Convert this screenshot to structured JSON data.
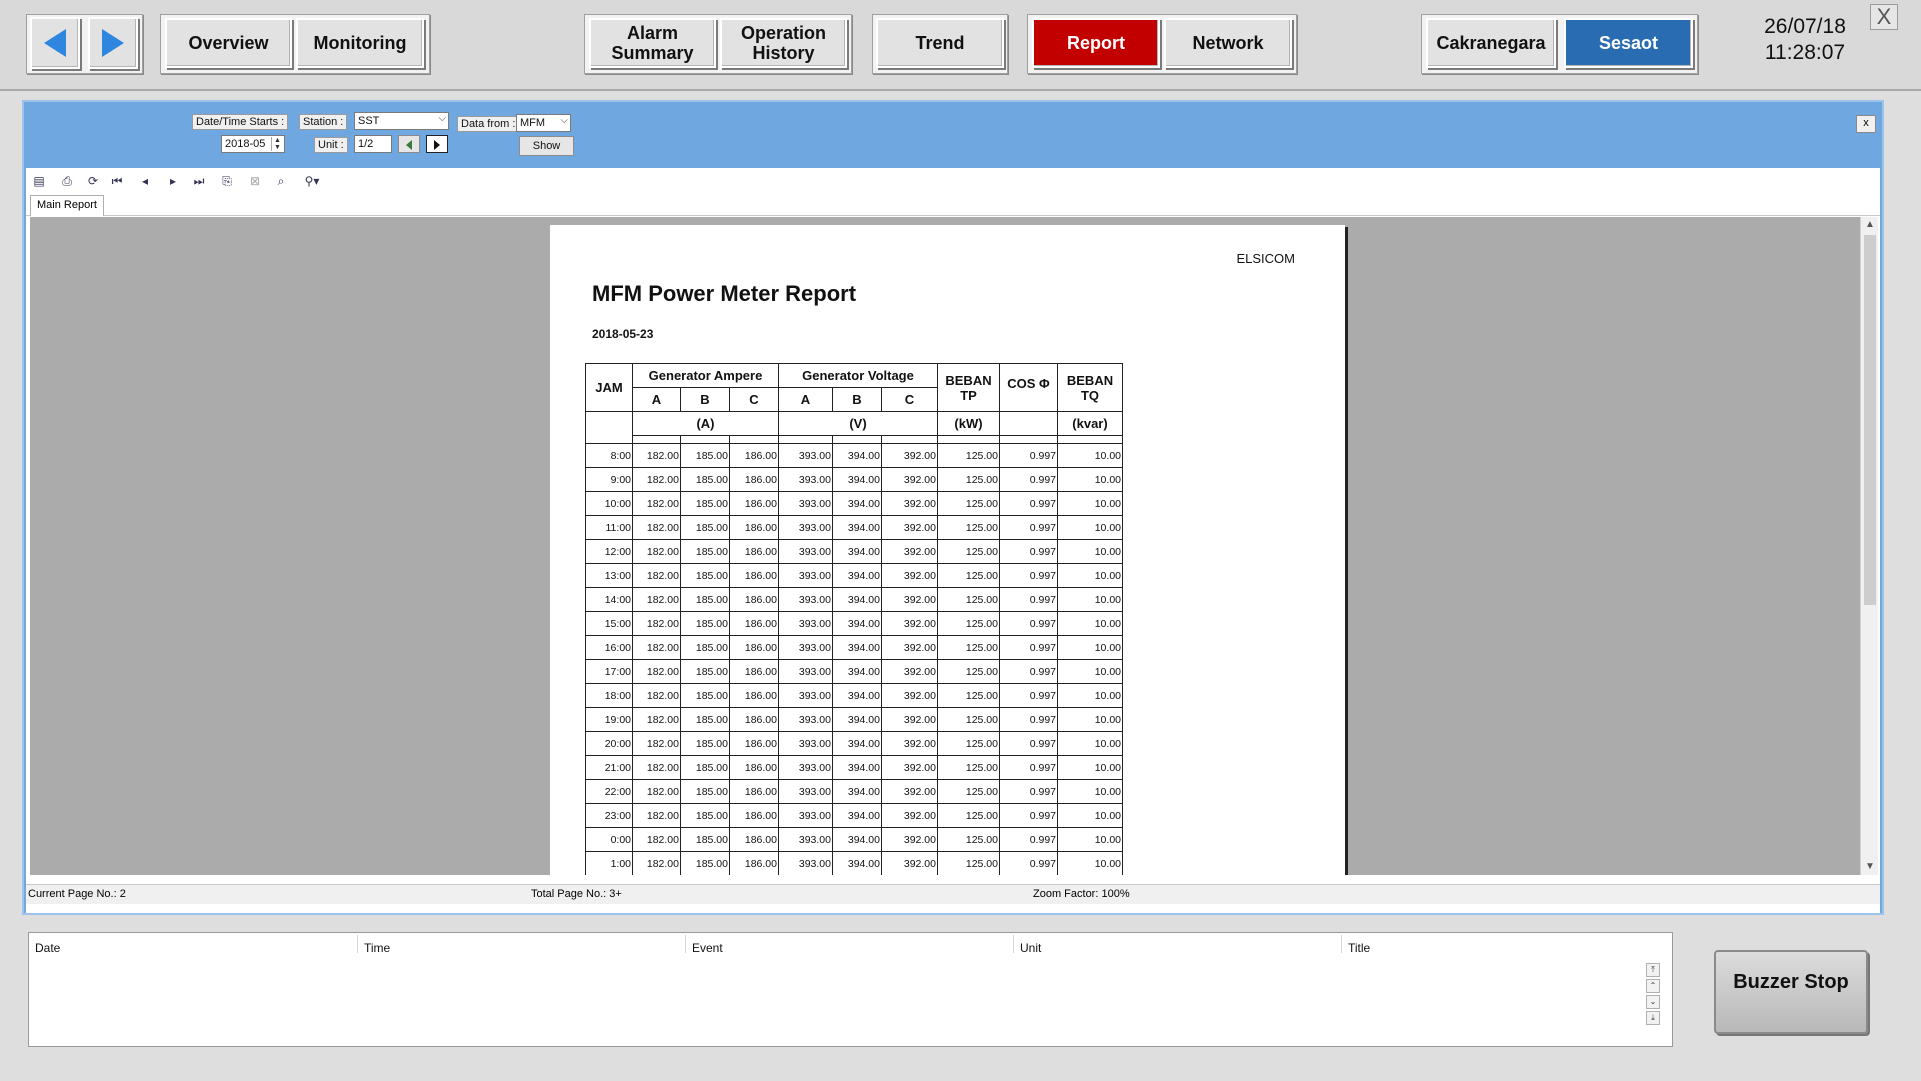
{
  "nav": {
    "back_icon": "arrow-left-icon",
    "forward_icon": "arrow-right-icon",
    "overview": "Overview",
    "monitoring": "Monitoring",
    "alarm_summary": "Alarm Summary",
    "operation_history": "Operation History",
    "trend": "Trend",
    "report": "Report",
    "network": "Network",
    "cakranegara": "Cakranegara",
    "sesaot": "Sesaot",
    "date": "26/07/18",
    "time": "11:28:07",
    "close": "X",
    "colors": {
      "active_report": "#c30000",
      "active_station": "#2a6cb2",
      "nav_arrow": "#2e86de"
    }
  },
  "filter": {
    "datetime_label": "Date/Time Starts :",
    "datetime_value": "2018-05",
    "station_label": "Station :",
    "station_value": "SST",
    "unit_label": "Unit :",
    "unit_value": "1/2",
    "datafrom_label": "Data from :",
    "datafrom_value": "MFM",
    "show_button": "Show",
    "close": "x"
  },
  "viewer": {
    "tab": "Main Report",
    "status_current": "Current Page No.: 2",
    "status_total": "Total Page No.: 3+",
    "status_zoom": "Zoom Factor: 100%"
  },
  "report": {
    "company": "ELSICOM",
    "title": "MFM Power Meter Report",
    "date": "2018-05-23",
    "headers": {
      "jam": "JAM",
      "gen_ampere": "Generator Ampere",
      "gen_voltage": "Generator Voltage",
      "a": "A",
      "b": "B",
      "c": "C",
      "ampere_unit": "(A)",
      "voltage_unit": "(V)",
      "beban_tp": "BEBAN TP",
      "beban_tp_unit": "(kW)",
      "cos": "COS Φ",
      "beban_tq": "BEBAN TQ",
      "beban_tq_unit": "(kvar)"
    },
    "rows": [
      [
        "8:00",
        "182.00",
        "185.00",
        "186.00",
        "393.00",
        "394.00",
        "392.00",
        "125.00",
        "0.997",
        "10.00"
      ],
      [
        "9:00",
        "182.00",
        "185.00",
        "186.00",
        "393.00",
        "394.00",
        "392.00",
        "125.00",
        "0.997",
        "10.00"
      ],
      [
        "10:00",
        "182.00",
        "185.00",
        "186.00",
        "393.00",
        "394.00",
        "392.00",
        "125.00",
        "0.997",
        "10.00"
      ],
      [
        "11:00",
        "182.00",
        "185.00",
        "186.00",
        "393.00",
        "394.00",
        "392.00",
        "125.00",
        "0.997",
        "10.00"
      ],
      [
        "12:00",
        "182.00",
        "185.00",
        "186.00",
        "393.00",
        "394.00",
        "392.00",
        "125.00",
        "0.997",
        "10.00"
      ],
      [
        "13:00",
        "182.00",
        "185.00",
        "186.00",
        "393.00",
        "394.00",
        "392.00",
        "125.00",
        "0.997",
        "10.00"
      ],
      [
        "14:00",
        "182.00",
        "185.00",
        "186.00",
        "393.00",
        "394.00",
        "392.00",
        "125.00",
        "0.997",
        "10.00"
      ],
      [
        "15:00",
        "182.00",
        "185.00",
        "186.00",
        "393.00",
        "394.00",
        "392.00",
        "125.00",
        "0.997",
        "10.00"
      ],
      [
        "16:00",
        "182.00",
        "185.00",
        "186.00",
        "393.00",
        "394.00",
        "392.00",
        "125.00",
        "0.997",
        "10.00"
      ],
      [
        "17:00",
        "182.00",
        "185.00",
        "186.00",
        "393.00",
        "394.00",
        "392.00",
        "125.00",
        "0.997",
        "10.00"
      ],
      [
        "18:00",
        "182.00",
        "185.00",
        "186.00",
        "393.00",
        "394.00",
        "392.00",
        "125.00",
        "0.997",
        "10.00"
      ],
      [
        "19:00",
        "182.00",
        "185.00",
        "186.00",
        "393.00",
        "394.00",
        "392.00",
        "125.00",
        "0.997",
        "10.00"
      ],
      [
        "20:00",
        "182.00",
        "185.00",
        "186.00",
        "393.00",
        "394.00",
        "392.00",
        "125.00",
        "0.997",
        "10.00"
      ],
      [
        "21:00",
        "182.00",
        "185.00",
        "186.00",
        "393.00",
        "394.00",
        "392.00",
        "125.00",
        "0.997",
        "10.00"
      ],
      [
        "22:00",
        "182.00",
        "185.00",
        "186.00",
        "393.00",
        "394.00",
        "392.00",
        "125.00",
        "0.997",
        "10.00"
      ],
      [
        "23:00",
        "182.00",
        "185.00",
        "186.00",
        "393.00",
        "394.00",
        "392.00",
        "125.00",
        "0.997",
        "10.00"
      ],
      [
        "0:00",
        "182.00",
        "185.00",
        "186.00",
        "393.00",
        "394.00",
        "392.00",
        "125.00",
        "0.997",
        "10.00"
      ],
      [
        "1:00",
        "182.00",
        "185.00",
        "186.00",
        "393.00",
        "394.00",
        "392.00",
        "125.00",
        "0.997",
        "10.00"
      ]
    ]
  },
  "eventlog": {
    "columns": [
      "Date",
      "Time",
      "Event",
      "Unit",
      "Title"
    ]
  },
  "buzzer": {
    "label": "Buzzer Stop"
  }
}
